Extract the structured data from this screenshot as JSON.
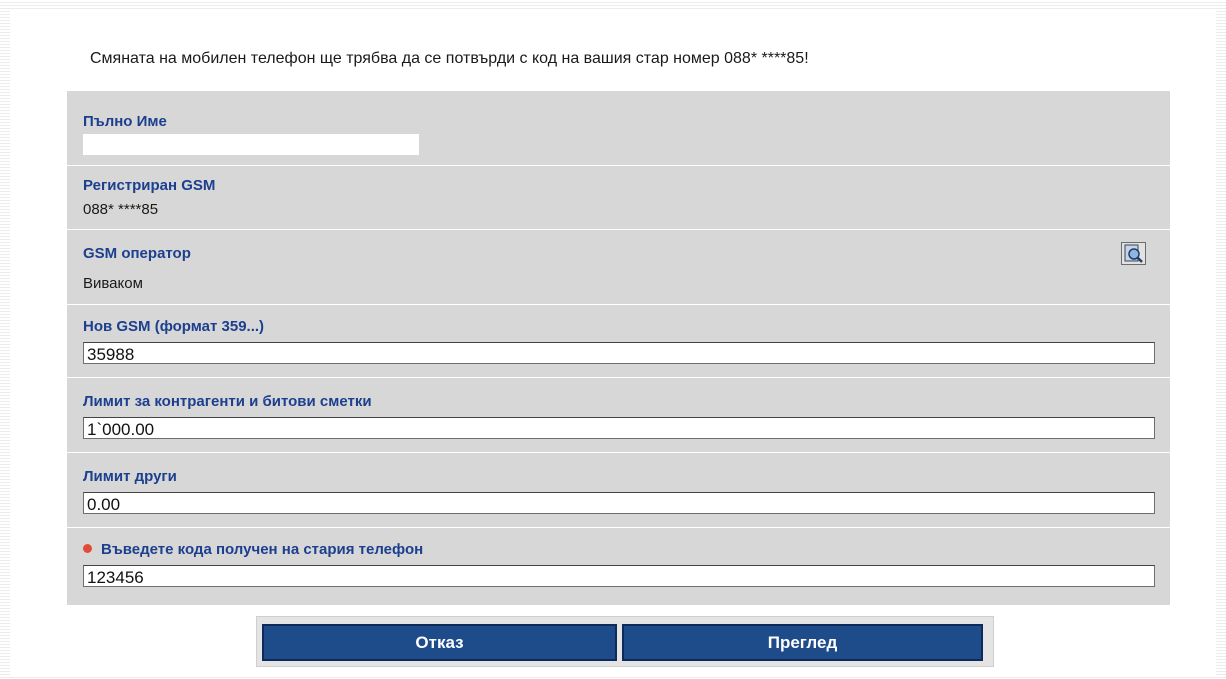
{
  "notice": "Смяната на мобилен телефон ще трябва да се потвърди с код на вашия стар номер 088* ****85!",
  "form": {
    "full_name": {
      "label": "Пълно Име",
      "value": ""
    },
    "registered_gsm": {
      "label": "Регистриран GSM",
      "value": "088* ****85"
    },
    "gsm_operator": {
      "label": "GSM оператор",
      "value": "Виваком",
      "lookup_icon": "search-document-icon"
    },
    "new_gsm": {
      "label": "Нов GSM (формат 359...)",
      "value": "35988"
    },
    "limit_contractors": {
      "label": "Лимит за контрагенти и битови сметки",
      "value": "1`000.00"
    },
    "limit_other": {
      "label": "Лимит други",
      "value": "0.00"
    },
    "old_phone_code": {
      "label": "Въведете кода получен на стария телефон",
      "value": "123456",
      "required_icon": "required-dot-icon"
    }
  },
  "buttons": {
    "cancel": "Отказ",
    "review": "Преглед"
  },
  "colors": {
    "label": "#1c3f8e",
    "panel": "#d7d7d7",
    "button": "#1e4b8a",
    "required": "#e24b38"
  }
}
